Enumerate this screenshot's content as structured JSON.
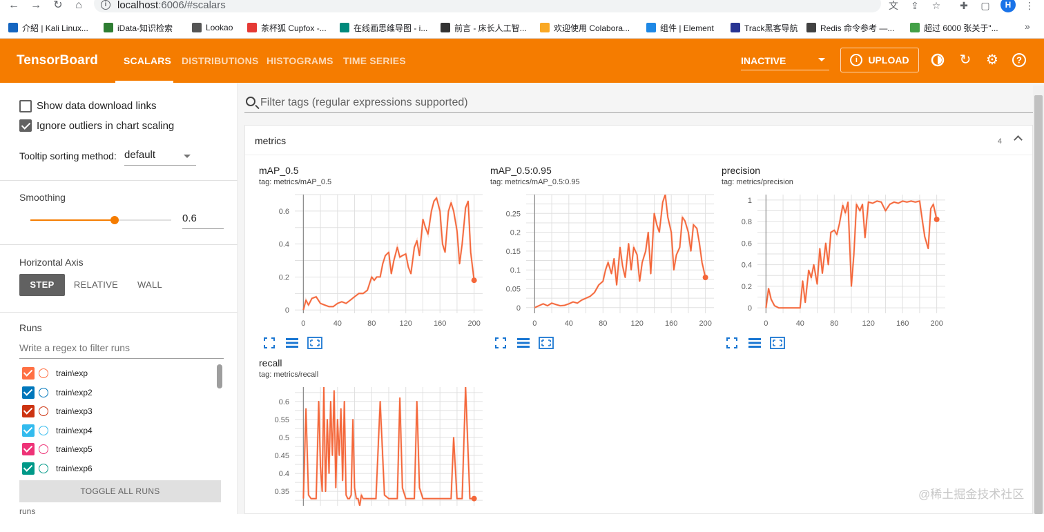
{
  "browser": {
    "url_host": "localhost",
    "url_path": ":6006/#scalars",
    "avatar_letter": "H",
    "bookmarks": [
      {
        "label": "介紹 | Kali Linux...",
        "color": "#1565c0"
      },
      {
        "label": "iData-知识检索",
        "color": "#2e7d32"
      },
      {
        "label": "Lookao",
        "color": "#555555"
      },
      {
        "label": "茶杯狐 Cupfox -...",
        "color": "#e53935"
      },
      {
        "label": "在线画思维导图 - i...",
        "color": "#00897b"
      },
      {
        "label": "前言 - 床长人工智...",
        "color": "#333333"
      },
      {
        "label": "欢迎使用 Colabora...",
        "color": "#f9a825"
      },
      {
        "label": "组件 | Element",
        "color": "#1e88e5"
      },
      {
        "label": "Track黑客导航",
        "color": "#283593"
      },
      {
        "label": "Redis 命令参考 —...",
        "color": "#424242"
      },
      {
        "label": "超过 6000 张关于\"...",
        "color": "#43a047"
      }
    ],
    "more": "»"
  },
  "header": {
    "brand": "TensorBoard",
    "tabs": [
      "SCALARS",
      "DISTRIBUTIONS",
      "HISTOGRAMS",
      "TIME SERIES"
    ],
    "active_tab": "SCALARS",
    "run_status": "INACTIVE",
    "upload_label": "UPLOAD",
    "accent_color": "#f57c00"
  },
  "sidebar": {
    "show_download_links": "Show data download links",
    "ignore_outliers": "Ignore outliers in chart scaling",
    "tooltip_label": "Tooltip sorting method:",
    "tooltip_value": "default",
    "smoothing_title": "Smoothing",
    "smoothing_value": "0.6",
    "smoothing_fraction": 0.6,
    "horizontal_axis_title": "Horizontal Axis",
    "axis_options": [
      "STEP",
      "RELATIVE",
      "WALL"
    ],
    "runs_title": "Runs",
    "runs_filter_placeholder": "Write a regex to filter runs",
    "runs": [
      {
        "name": "train\\exp",
        "color": "#ff7043"
      },
      {
        "name": "train\\exp2",
        "color": "#0077bb"
      },
      {
        "name": "train\\exp3",
        "color": "#cc3311"
      },
      {
        "name": "train\\exp4",
        "color": "#33bbee"
      },
      {
        "name": "train\\exp5",
        "color": "#ee3377"
      },
      {
        "name": "train\\exp6",
        "color": "#009988"
      }
    ],
    "toggle_all": "TOGGLE ALL RUNS",
    "footer": "runs"
  },
  "main": {
    "filter_placeholder": "Filter tags (regular expressions supported)",
    "group_title": "metrics",
    "group_count": "4",
    "watermark": "@稀土掘金技术社区"
  },
  "cards": [
    {
      "title": "mAP_0.5",
      "tag": "tag: metrics/mAP_0.5"
    },
    {
      "title": "mAP_0.5:0.95",
      "tag": "tag: metrics/mAP_0.5:0.95"
    },
    {
      "title": "precision",
      "tag": "tag: metrics/precision"
    },
    {
      "title": "recall",
      "tag": "tag: metrics/recall"
    }
  ],
  "chart_data": [
    {
      "type": "line",
      "title": "mAP_0.5",
      "xlim": [
        -10,
        210
      ],
      "ylim": [
        -0.02,
        0.7
      ],
      "xticks": [
        "0",
        "40",
        "80",
        "120",
        "160",
        "200"
      ],
      "xtick_values": [
        0,
        40,
        80,
        120,
        160,
        200
      ],
      "yticks": [
        "0",
        "0.2",
        "0.4",
        "0.6"
      ],
      "ytick_values": [
        0,
        0.2,
        0.4,
        0.6
      ],
      "series": [
        {
          "color": "#f4673a",
          "x": [
            0,
            3,
            6,
            10,
            15,
            20,
            25,
            30,
            35,
            40,
            45,
            50,
            55,
            60,
            65,
            70,
            75,
            80,
            83,
            86,
            90,
            93,
            96,
            100,
            103,
            106,
            110,
            113,
            116,
            120,
            123,
            126,
            130,
            133,
            136,
            140,
            143,
            146,
            150,
            153,
            156,
            160,
            163,
            166,
            170,
            173,
            176,
            180,
            183,
            186,
            190,
            193,
            196,
            200
          ],
          "y": [
            0.0,
            0.06,
            0.03,
            0.07,
            0.08,
            0.04,
            0.03,
            0.02,
            0.02,
            0.04,
            0.05,
            0.04,
            0.06,
            0.08,
            0.1,
            0.1,
            0.12,
            0.2,
            0.18,
            0.2,
            0.2,
            0.28,
            0.33,
            0.35,
            0.22,
            0.3,
            0.38,
            0.32,
            0.33,
            0.34,
            0.26,
            0.22,
            0.38,
            0.42,
            0.33,
            0.55,
            0.5,
            0.46,
            0.6,
            0.66,
            0.68,
            0.6,
            0.4,
            0.35,
            0.6,
            0.65,
            0.6,
            0.48,
            0.28,
            0.4,
            0.62,
            0.66,
            0.35,
            0.18
          ]
        }
      ]
    },
    {
      "type": "line",
      "title": "mAP_0.5:0.95",
      "xlim": [
        -10,
        210
      ],
      "ylim": [
        -0.015,
        0.3
      ],
      "xticks": [
        "0",
        "40",
        "80",
        "120",
        "160",
        "200"
      ],
      "xtick_values": [
        0,
        40,
        80,
        120,
        160,
        200
      ],
      "yticks": [
        "0",
        "0.05",
        "0.1",
        "0.15",
        "0.2",
        "0.25"
      ],
      "ytick_values": [
        0,
        0.05,
        0.1,
        0.15,
        0.2,
        0.25
      ],
      "series": [
        {
          "color": "#f4673a",
          "x": [
            0,
            5,
            10,
            15,
            20,
            25,
            30,
            35,
            40,
            45,
            50,
            55,
            60,
            65,
            70,
            75,
            80,
            83,
            86,
            90,
            93,
            96,
            100,
            103,
            106,
            110,
            113,
            116,
            120,
            123,
            126,
            130,
            133,
            136,
            140,
            143,
            146,
            150,
            153,
            156,
            160,
            163,
            166,
            170,
            173,
            176,
            180,
            183,
            186,
            190,
            193,
            196,
            200
          ],
          "y": [
            0.0,
            0.005,
            0.01,
            0.005,
            0.012,
            0.008,
            0.005,
            0.006,
            0.01,
            0.015,
            0.012,
            0.02,
            0.025,
            0.03,
            0.04,
            0.06,
            0.07,
            0.1,
            0.12,
            0.09,
            0.13,
            0.06,
            0.16,
            0.11,
            0.08,
            0.17,
            0.1,
            0.16,
            0.14,
            0.07,
            0.12,
            0.15,
            0.2,
            0.09,
            0.25,
            0.22,
            0.2,
            0.28,
            0.3,
            0.24,
            0.2,
            0.1,
            0.14,
            0.16,
            0.24,
            0.23,
            0.2,
            0.15,
            0.22,
            0.21,
            0.17,
            0.12,
            0.08
          ]
        }
      ]
    },
    {
      "type": "line",
      "title": "precision",
      "xlim": [
        -10,
        210
      ],
      "ylim": [
        -0.05,
        1.05
      ],
      "xticks": [
        "0",
        "40",
        "80",
        "120",
        "160",
        "200"
      ],
      "xtick_values": [
        0,
        40,
        80,
        120,
        160,
        200
      ],
      "yticks": [
        "0",
        "0.2",
        "0.4",
        "0.6",
        "0.8",
        "1"
      ],
      "ytick_values": [
        0,
        0.2,
        0.4,
        0.6,
        0.8,
        1
      ],
      "series": [
        {
          "color": "#f4673a",
          "x": [
            0,
            3,
            6,
            10,
            15,
            20,
            25,
            30,
            35,
            40,
            43,
            46,
            50,
            53,
            56,
            60,
            63,
            66,
            70,
            73,
            76,
            80,
            83,
            86,
            90,
            93,
            96,
            100,
            103,
            106,
            110,
            113,
            116,
            120,
            125,
            130,
            135,
            140,
            145,
            150,
            155,
            160,
            165,
            170,
            175,
            180,
            183,
            186,
            190,
            193,
            196,
            200
          ],
          "y": [
            0.0,
            0.18,
            0.08,
            0.02,
            0.0,
            0.0,
            0.0,
            0.0,
            0.0,
            0.0,
            0.25,
            0.05,
            0.35,
            0.28,
            0.4,
            0.22,
            0.55,
            0.32,
            0.6,
            0.4,
            0.7,
            0.72,
            0.68,
            0.78,
            0.95,
            0.88,
            0.98,
            0.2,
            0.5,
            0.96,
            0.9,
            0.96,
            0.65,
            0.98,
            0.97,
            0.99,
            0.98,
            0.9,
            0.96,
            0.98,
            0.97,
            0.99,
            0.98,
            0.99,
            0.98,
            0.99,
            0.82,
            0.66,
            0.55,
            0.92,
            0.96,
            0.82
          ]
        }
      ]
    },
    {
      "type": "line",
      "title": "recall",
      "xlim": [
        -10,
        210
      ],
      "ylim": [
        0.31,
        0.64
      ],
      "xticks": [],
      "xtick_values": [],
      "yticks": [
        "0.35",
        "0.4",
        "0.45",
        "0.5",
        "0.55",
        "0.6"
      ],
      "ytick_values": [
        0.35,
        0.4,
        0.45,
        0.5,
        0.55,
        0.6
      ],
      "series": [
        {
          "color": "#f4673a",
          "x": [
            0,
            3,
            6,
            9,
            12,
            15,
            18,
            20,
            22,
            24,
            26,
            28,
            30,
            32,
            34,
            36,
            38,
            40,
            42,
            44,
            46,
            48,
            50,
            52,
            54,
            56,
            58,
            60,
            62,
            64,
            66,
            68,
            70,
            75,
            80,
            85,
            90,
            95,
            100,
            105,
            110,
            113,
            116,
            120,
            125,
            130,
            133,
            136,
            140,
            145,
            150,
            155,
            160,
            163,
            166,
            170,
            173,
            176,
            180,
            183,
            186,
            190,
            195,
            200
          ],
          "y": [
            0.33,
            0.58,
            0.34,
            0.33,
            0.33,
            0.33,
            0.6,
            0.42,
            0.35,
            0.64,
            0.35,
            0.55,
            0.4,
            0.6,
            0.45,
            0.63,
            0.36,
            0.55,
            0.45,
            0.58,
            0.38,
            0.6,
            0.34,
            0.33,
            0.33,
            0.34,
            0.55,
            0.36,
            0.33,
            0.33,
            0.31,
            0.34,
            0.33,
            0.33,
            0.33,
            0.33,
            0.6,
            0.34,
            0.33,
            0.33,
            0.33,
            0.61,
            0.36,
            0.33,
            0.33,
            0.33,
            0.6,
            0.36,
            0.33,
            0.33,
            0.33,
            0.33,
            0.33,
            0.33,
            0.33,
            0.33,
            0.33,
            0.5,
            0.33,
            0.33,
            0.33,
            0.64,
            0.33,
            0.33
          ]
        }
      ]
    }
  ]
}
